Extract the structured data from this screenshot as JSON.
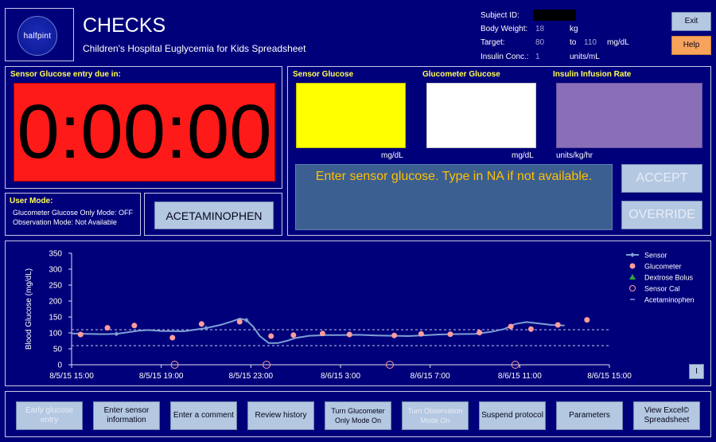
{
  "header": {
    "logo_text": "halfpint",
    "title": "CHECKS",
    "subtitle": "Children's Hospital Euglycemia for Kids Spreadsheet",
    "subject_id_label": "Subject ID:",
    "body_weight_label": "Body Weight:",
    "body_weight_value": "18",
    "body_weight_unit": "kg",
    "target_label": "Target:",
    "target_low": "80",
    "target_to": "to",
    "target_high": "110",
    "target_unit": "mg/dL",
    "insulin_conc_label": "Insulin Conc.:",
    "insulin_conc_value": "1",
    "insulin_conc_unit": "units/mL",
    "exit_label": "Exit",
    "help_label": "Help"
  },
  "timer": {
    "label": "Sensor Glucose entry due in:",
    "value": "0:00:00"
  },
  "user_mode": {
    "label": "User Mode:",
    "line1": "Glucometer Glucose Only Mode: OFF",
    "line2": "Observation Mode: Not Available",
    "acetaminophen_label": "ACETAMINOPHEN"
  },
  "entry": {
    "sensor_label": "Sensor Glucose",
    "sensor_unit": "mg/dL",
    "glucometer_label": "Glucometer Glucose",
    "glucometer_unit": "mg/dL",
    "insulin_label": "Insulin Infusion Rate",
    "insulin_unit": "units/kg/hr",
    "message": "Enter sensor glucose. Type in NA if not available.",
    "accept_label": "ACCEPT",
    "override_label": "OVERRIDE"
  },
  "colors": {
    "background": "#00007a",
    "timer_bg": "#ff1a1a",
    "sensor_box": "#ffff00",
    "glucometer_box": "#ffffff",
    "insulin_box": "#8a6fb8",
    "message_bg": "#3c5f91",
    "message_text": "#ffc000",
    "sensor_line": "#7e9fd4",
    "glucometer_dot": "#ff9d9d",
    "dextrose": "#2ea83a",
    "help_button": "#f7a35c"
  },
  "chart_data": {
    "type": "line",
    "ylabel": "Blood  Glucose  (mg/dL)",
    "ylim": [
      0,
      350
    ],
    "yticks": [
      "0",
      "50",
      "100",
      "150",
      "200",
      "250",
      "300",
      "350"
    ],
    "xticks": [
      "8/5/15 15:00",
      "8/5/15 19:00",
      "8/5/15 23:00",
      "8/6/15 3:00",
      "8/6/15 7:00",
      "8/6/15 11:00",
      "8/6/15 15:00"
    ],
    "xlim_hours": [
      0,
      24
    ],
    "target_lines": [
      60,
      110
    ],
    "legend": [
      "Sensor",
      "Glucometer",
      "Dextrose Bolus",
      "Sensor Cal",
      "Acetaminophen"
    ],
    "legend_position": "right",
    "sensor": [
      [
        0,
        98
      ],
      [
        0.7,
        97
      ],
      [
        1.4,
        96
      ],
      [
        2,
        97
      ],
      [
        3,
        107
      ],
      [
        3.4,
        109
      ],
      [
        4,
        106
      ],
      [
        5,
        105
      ],
      [
        6,
        115
      ],
      [
        6.7,
        126
      ],
      [
        7.2,
        137
      ],
      [
        7.5,
        145
      ],
      [
        7.8,
        140
      ],
      [
        8.1,
        120
      ],
      [
        8.4,
        90
      ],
      [
        8.8,
        68
      ],
      [
        9.2,
        68
      ],
      [
        9.6,
        75
      ],
      [
        10,
        84
      ],
      [
        10.6,
        91
      ],
      [
        11.4,
        93
      ],
      [
        12,
        93
      ],
      [
        12.8,
        94
      ],
      [
        13.6,
        92
      ],
      [
        14.4,
        91
      ],
      [
        15,
        90
      ],
      [
        15.6,
        92
      ],
      [
        16.4,
        95
      ],
      [
        17,
        96
      ],
      [
        18,
        97
      ],
      [
        18.7,
        103
      ],
      [
        19.3,
        112
      ],
      [
        19.8,
        128
      ],
      [
        20.3,
        134
      ],
      [
        20.8,
        130
      ],
      [
        21.4,
        125
      ],
      [
        22,
        123
      ]
    ],
    "glucometer": [
      [
        0.4,
        95
      ],
      [
        1.6,
        116
      ],
      [
        2.8,
        123
      ],
      [
        4.5,
        85
      ],
      [
        5.8,
        128
      ],
      [
        7.5,
        135
      ],
      [
        8.9,
        90
      ],
      [
        9.9,
        93
      ],
      [
        11.2,
        98
      ],
      [
        12.4,
        95
      ],
      [
        14.4,
        92
      ],
      [
        15.6,
        97
      ],
      [
        16.9,
        96
      ],
      [
        18.2,
        101
      ],
      [
        19.6,
        120
      ],
      [
        20.5,
        112
      ],
      [
        21.7,
        125
      ],
      [
        23,
        141
      ]
    ],
    "sensor_cal": [
      [
        4.6,
        0
      ],
      [
        8.7,
        0
      ],
      [
        14.2,
        0
      ],
      [
        19.8,
        0
      ]
    ],
    "dextrose_bolus": [],
    "acetaminophen": []
  },
  "chart_button_label": "I",
  "bottom_buttons": [
    {
      "label": "Early glucose entry",
      "disabled": true
    },
    {
      "label": "Enter sensor information",
      "disabled": false
    },
    {
      "label": "Enter a comment",
      "disabled": false
    },
    {
      "label": "Review history",
      "disabled": false
    },
    {
      "label": "Turn Glucometer Only Mode On",
      "disabled": false
    },
    {
      "label": "Turn Observation Mode On",
      "disabled": true
    },
    {
      "label": "Suspend protocol",
      "disabled": false
    },
    {
      "label": "Parameters",
      "disabled": false
    },
    {
      "label": "View Excel© Spreadsheet",
      "disabled": false
    }
  ]
}
